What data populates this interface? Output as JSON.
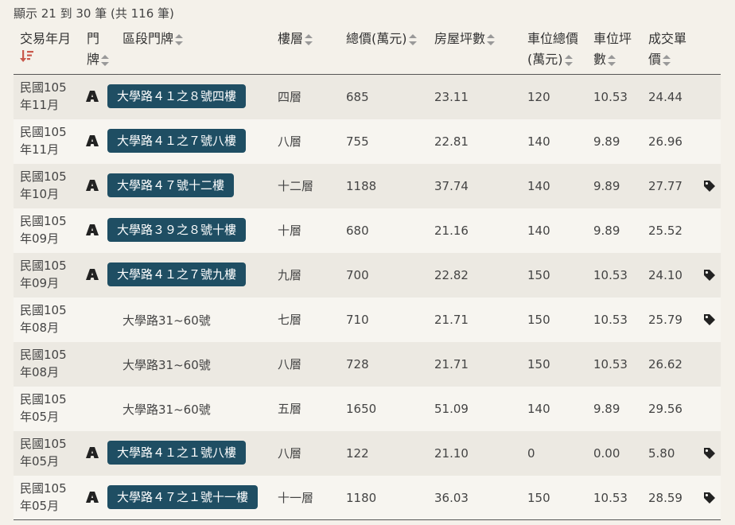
{
  "summary": "顯示 21 到 30 筆 (共 116 筆)",
  "headers": {
    "date_l1": "交易年月",
    "door_l1": "門",
    "door_l2": "牌",
    "addr": "區段門牌",
    "floor": "樓層",
    "total": "總價(萬元)",
    "area": "房屋坪數",
    "park_total_l1": "車位總價",
    "park_total_l2": "(萬元)",
    "park_area_l1": "車位坪",
    "park_area_l2": "數",
    "unit_l1": "成交單",
    "unit_l2": "價"
  },
  "rows": [
    {
      "date_l1": "民國105",
      "date_l2": "年11月",
      "icon": true,
      "badge": true,
      "address": "大學路４１之８號四樓",
      "floor": "四層",
      "total": "685",
      "area": "23.11",
      "park_total": "120",
      "park_area": "10.53",
      "unit": "24.44",
      "tag": false
    },
    {
      "date_l1": "民國105",
      "date_l2": "年11月",
      "icon": true,
      "badge": true,
      "address": "大學路４１之７號八樓",
      "floor": "八層",
      "total": "755",
      "area": "22.81",
      "park_total": "140",
      "park_area": "9.89",
      "unit": "26.96",
      "tag": false
    },
    {
      "date_l1": "民國105",
      "date_l2": "年10月",
      "icon": true,
      "badge": true,
      "address": "大學路４７號十二樓",
      "floor": "十二層",
      "total": "1188",
      "area": "37.74",
      "park_total": "140",
      "park_area": "9.89",
      "unit": "27.77",
      "tag": true
    },
    {
      "date_l1": "民國105",
      "date_l2": "年09月",
      "icon": true,
      "badge": true,
      "address": "大學路３９之８號十樓",
      "floor": "十層",
      "total": "680",
      "area": "21.16",
      "park_total": "140",
      "park_area": "9.89",
      "unit": "25.52",
      "tag": false
    },
    {
      "date_l1": "民國105",
      "date_l2": "年09月",
      "icon": true,
      "badge": true,
      "address": "大學路４１之７號九樓",
      "floor": "九層",
      "total": "700",
      "area": "22.82",
      "park_total": "150",
      "park_area": "10.53",
      "unit": "24.10",
      "tag": true
    },
    {
      "date_l1": "民國105",
      "date_l2": "年08月",
      "icon": false,
      "badge": false,
      "address": "大學路31~60號",
      "floor": "七層",
      "total": "710",
      "area": "21.71",
      "park_total": "150",
      "park_area": "10.53",
      "unit": "25.79",
      "tag": true
    },
    {
      "date_l1": "民國105",
      "date_l2": "年08月",
      "icon": false,
      "badge": false,
      "address": "大學路31~60號",
      "floor": "八層",
      "total": "728",
      "area": "21.71",
      "park_total": "150",
      "park_area": "10.53",
      "unit": "26.62",
      "tag": false
    },
    {
      "date_l1": "民國105",
      "date_l2": "年05月",
      "icon": false,
      "badge": false,
      "address": "大學路31~60號",
      "floor": "五層",
      "total": "1650",
      "area": "51.09",
      "park_total": "140",
      "park_area": "9.89",
      "unit": "29.56",
      "tag": false
    },
    {
      "date_l1": "民國105",
      "date_l2": "年05月",
      "icon": true,
      "badge": true,
      "address": "大學路４１之１號八樓",
      "floor": "八層",
      "total": "122",
      "area": "21.10",
      "park_total": "0",
      "park_area": "0.00",
      "unit": "5.80",
      "tag": true
    },
    {
      "date_l1": "民國105",
      "date_l2": "年05月",
      "icon": true,
      "badge": true,
      "address": "大學路４７之１號十一樓",
      "floor": "十一層",
      "total": "1180",
      "area": "36.03",
      "park_total": "150",
      "park_area": "10.53",
      "unit": "28.59",
      "tag": true
    }
  ],
  "colors": {
    "badge": "#1f4e63",
    "sort_active": "#c9594c",
    "row_odd": "#ece9e2",
    "row_even": "#f7f5f0"
  }
}
